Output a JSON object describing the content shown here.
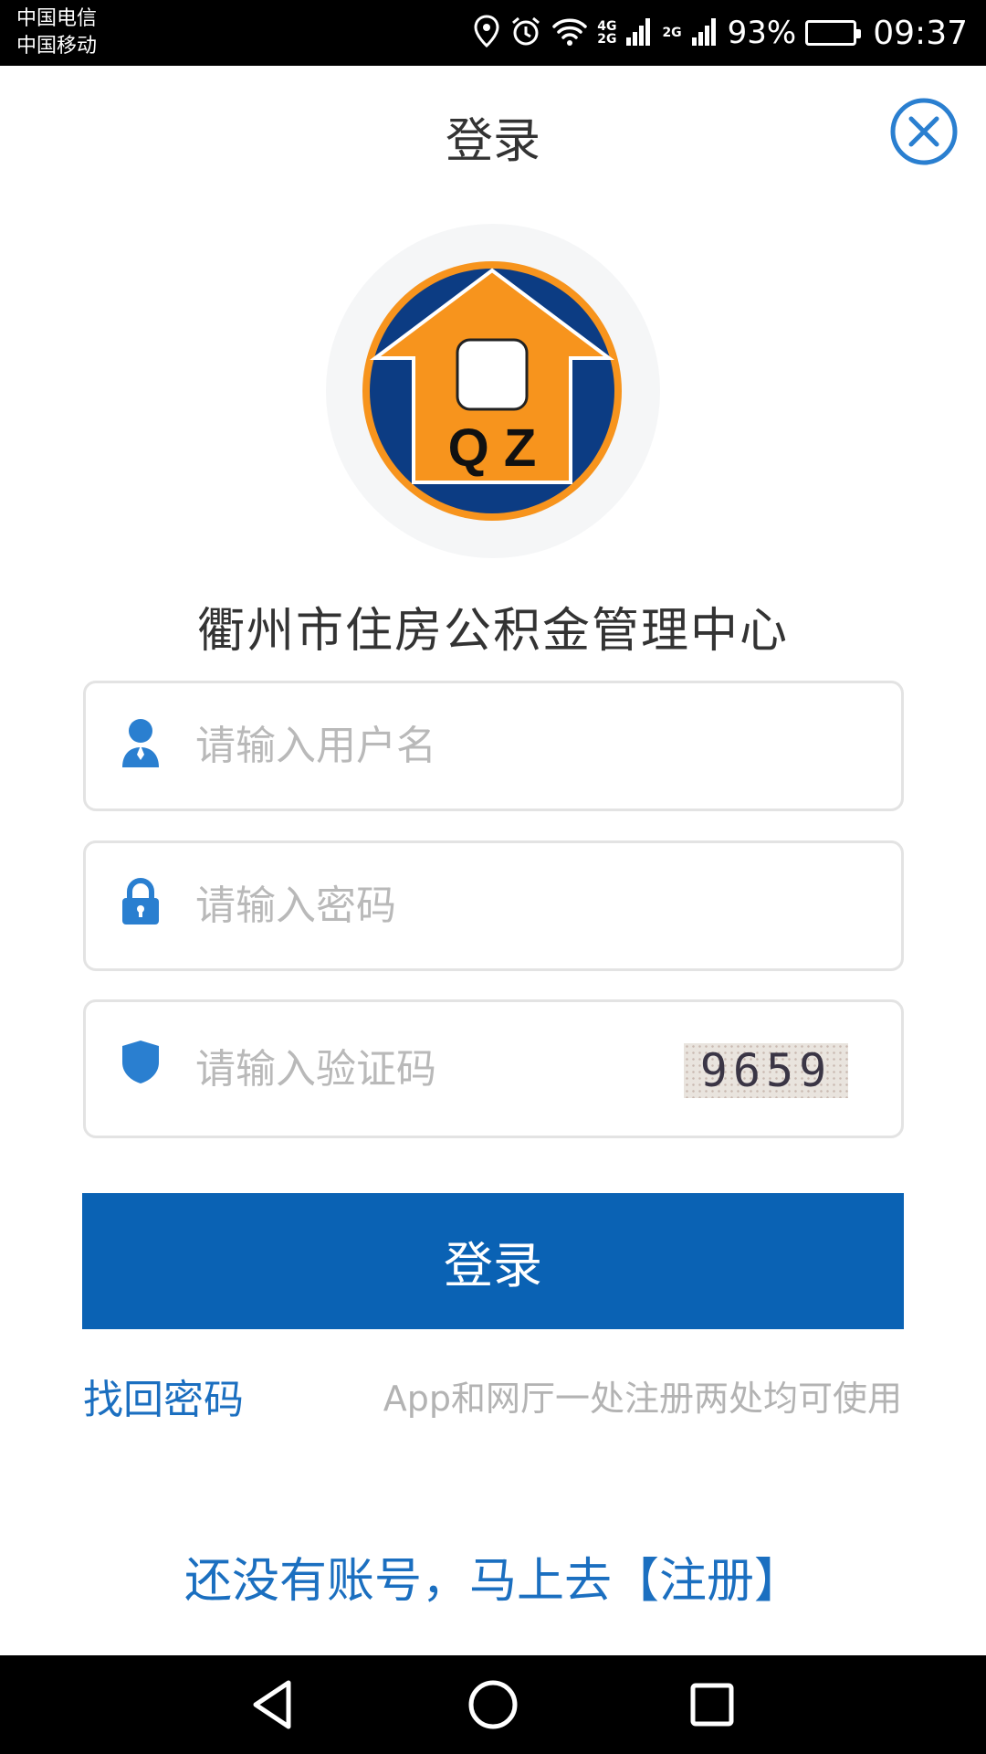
{
  "status_bar": {
    "carrier_1": "中国电信",
    "carrier_2": "中国移动",
    "net_1_top": "4G",
    "net_1_bottom": "2G",
    "net_2": "2G",
    "battery_percent": "93%",
    "battery_level": 0.93,
    "time": "09:37"
  },
  "header": {
    "title": "登录"
  },
  "logo": {
    "text": "Q Z",
    "colors": {
      "orange": "#f7941d",
      "navy": "#0c3c83"
    }
  },
  "org_name": "衢州市住房公积金管理中心",
  "form": {
    "username_placeholder": "请输入用户名",
    "password_placeholder": "请输入密码",
    "captcha_placeholder": "请输入验证码",
    "captcha_code": "9659"
  },
  "login_button": "登录",
  "forgot_password": "找回密码",
  "tip": "App和网厅一处注册两处均可使用",
  "register_prompt": "还没有账号，马上去【注册】",
  "colors": {
    "primary": "#0a62b4",
    "link": "#1b6fc0",
    "icon": "#2a7fd0"
  }
}
